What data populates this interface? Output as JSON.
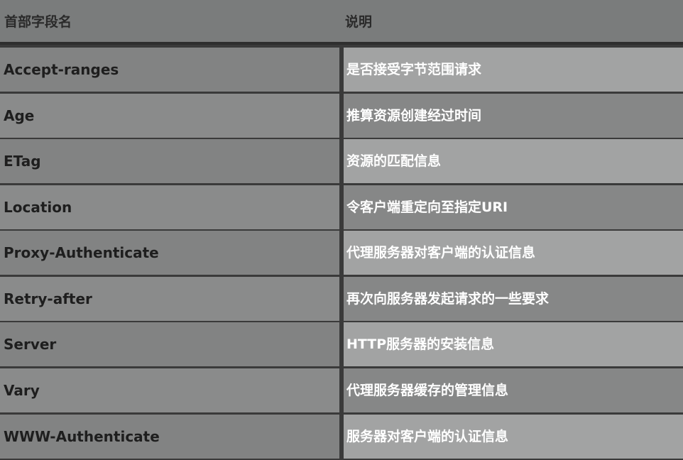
{
  "headers": [
    "首部字段名",
    "说明"
  ],
  "rows": [
    {
      "field": "Accept-ranges",
      "desc": "是否接受字节范围请求"
    },
    {
      "field": "Age",
      "desc": "推算资源创建经过时间"
    },
    {
      "field": "ETag",
      "desc": "资源的匹配信息"
    },
    {
      "field": "Location",
      "desc": "令客户端重定向至指定URI"
    },
    {
      "field": "Proxy-Authenticate",
      "desc": "代理服务器对客户端的认证信息"
    },
    {
      "field": "Retry-after",
      "desc": "再次向服务器发起请求的一些要求"
    },
    {
      "field": "Server",
      "desc": "HTTP服务器的安装信息"
    },
    {
      "field": "Vary",
      "desc": "代理服务器缓存的管理信息"
    },
    {
      "field": "WWW-Authenticate",
      "desc": "服务器对客户端的认证信息"
    }
  ]
}
